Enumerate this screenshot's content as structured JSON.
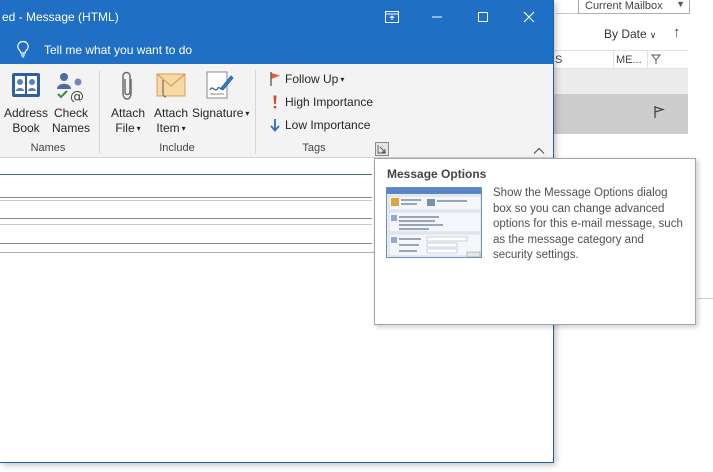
{
  "window": {
    "title": "ed  -  Message (HTML)",
    "colors": {
      "titlebar": "#1f6fc5",
      "ribbon": "#f3f3f3"
    }
  },
  "tell_me": {
    "text": "Tell me what you want to do"
  },
  "background": {
    "mailbox_label": "Current Mailbox",
    "sort_label": "By Date",
    "column_headers": [
      "S",
      "ME..."
    ]
  },
  "ribbon": {
    "groups": [
      {
        "label": "Names",
        "buttons": [
          {
            "line1": "Address",
            "line2": "Book",
            "icon": "address-book-icon"
          },
          {
            "line1": "Check",
            "line2": "Names",
            "icon": "check-names-icon"
          }
        ]
      },
      {
        "label": "Include",
        "buttons": [
          {
            "line1": "Attach",
            "line2": "File",
            "icon": "paperclip-icon"
          },
          {
            "line1": "Attach",
            "line2": "Item",
            "icon": "envelope-icon"
          },
          {
            "line1": "Signature",
            "line2": "",
            "icon": "signature-icon"
          }
        ]
      },
      {
        "label": "Tags",
        "items": [
          {
            "label": "Follow Up",
            "icon": "flag-icon"
          },
          {
            "label": "High Importance",
            "icon": "exclamation-icon"
          },
          {
            "label": "Low Importance",
            "icon": "down-arrow-icon"
          }
        ]
      }
    ]
  },
  "tooltip": {
    "title": "Message Options",
    "description": "Show the Message Options dialog box so you can change advanced options for this e-mail message, such as the message category and security settings."
  }
}
